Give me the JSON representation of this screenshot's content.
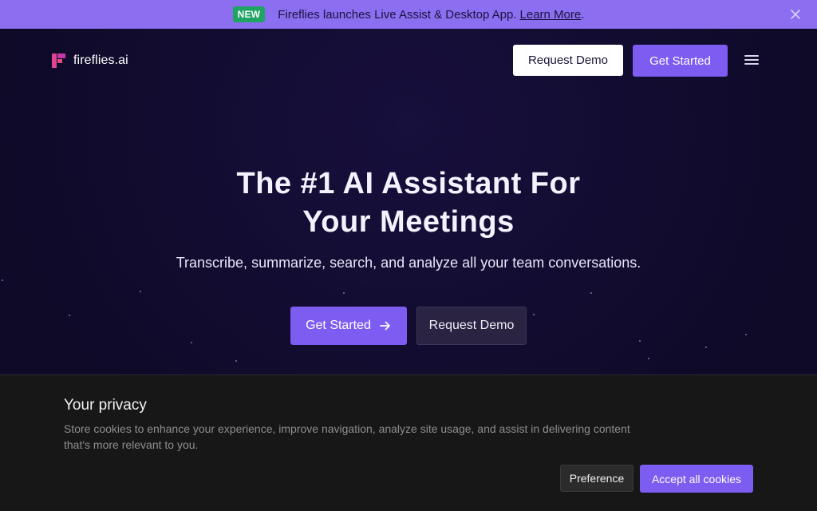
{
  "announcement": {
    "badge": "NEW",
    "message": "Fireflies launches Live Assist & Desktop App.",
    "link_label": "Learn More",
    "trailing": ".",
    "close_icon": "close-icon"
  },
  "header": {
    "logo_text": "fireflies.ai",
    "request_demo_label": "Request Demo",
    "get_started_label": "Get Started",
    "menu_icon": "hamburger-menu-icon"
  },
  "hero": {
    "headline_line1": "The #1 AI Assistant For",
    "headline_line2": "Your Meetings",
    "subheadline": "Transcribe, summarize, search, and analyze all your team conversations.",
    "primary_cta_label": "Get Started",
    "secondary_cta_label": "Request Demo",
    "arrow_icon": "arrow-right-icon"
  },
  "cookie_banner": {
    "title": "Your privacy",
    "body": "Store cookies to enhance your experience, improve navigation, analyze site usage, and assist in delivering content that's more relevant to you.",
    "preference_label": "Preference",
    "accept_label": "Accept all cookies"
  },
  "colors": {
    "brand_purple": "#7d5cf2",
    "announcement_bg": "#8b6ff0",
    "hero_bg": "#120b2e",
    "badge_green": "#1fa463",
    "cookie_bg": "#171717"
  }
}
